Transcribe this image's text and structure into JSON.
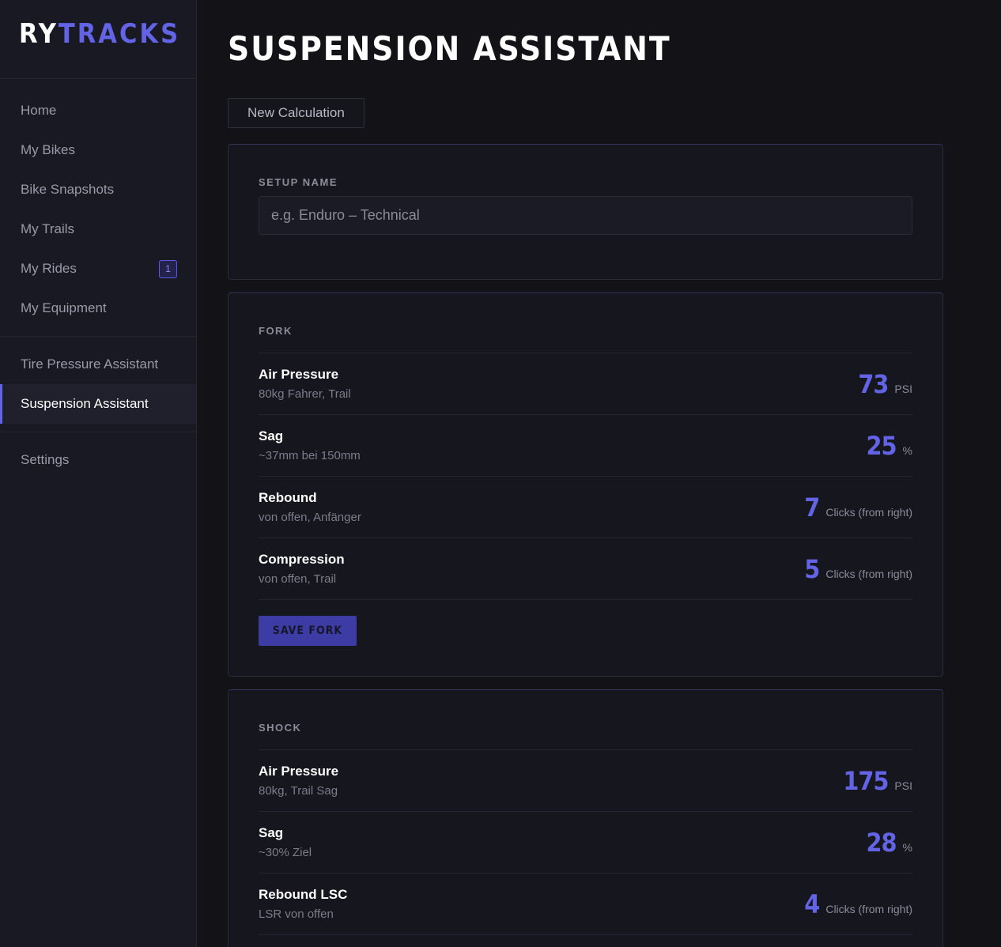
{
  "logo": {
    "part1": "RY",
    "part2": "TRACKS"
  },
  "sidebar": {
    "group1": [
      {
        "label": "Home"
      },
      {
        "label": "My Bikes"
      },
      {
        "label": "Bike Snapshots"
      },
      {
        "label": "My Trails"
      },
      {
        "label": "My Rides",
        "badge": "1"
      },
      {
        "label": "My Equipment"
      }
    ],
    "group2": [
      {
        "label": "Tire Pressure Assistant"
      },
      {
        "label": "Suspension Assistant",
        "active": true
      }
    ],
    "group3": [
      {
        "label": "Settings"
      }
    ]
  },
  "main": {
    "title": "SUSPENSION ASSISTANT",
    "new_calc_label": "New Calculation",
    "setup": {
      "label": "SETUP NAME",
      "placeholder": "e.g. Enduro – Technical",
      "value": ""
    },
    "fork": {
      "label": "FORK",
      "rows": [
        {
          "name": "Air Pressure",
          "sub": "80kg Fahrer, Trail",
          "value": "73",
          "unit": "PSI"
        },
        {
          "name": "Sag",
          "sub": "~37mm bei 150mm",
          "value": "25",
          "unit": "%"
        },
        {
          "name": "Rebound",
          "sub": "von offen, Anfänger",
          "value": "7",
          "unit": "Clicks (from right)"
        },
        {
          "name": "Compression",
          "sub": "von offen, Trail",
          "value": "5",
          "unit": "Clicks (from right)"
        }
      ],
      "save_label": "SAVE FORK"
    },
    "shock": {
      "label": "SHOCK",
      "rows": [
        {
          "name": "Air Pressure",
          "sub": "80kg, Trail Sag",
          "value": "175",
          "unit": "PSI"
        },
        {
          "name": "Sag",
          "sub": "~30% Ziel",
          "value": "28",
          "unit": "%"
        },
        {
          "name": "Rebound LSC",
          "sub": "LSR von offen",
          "value": "4",
          "unit": "Clicks (from right)"
        }
      ]
    }
  },
  "colors": {
    "accent": "#6363e6",
    "background": "#121217",
    "sidebar": "#191923"
  }
}
